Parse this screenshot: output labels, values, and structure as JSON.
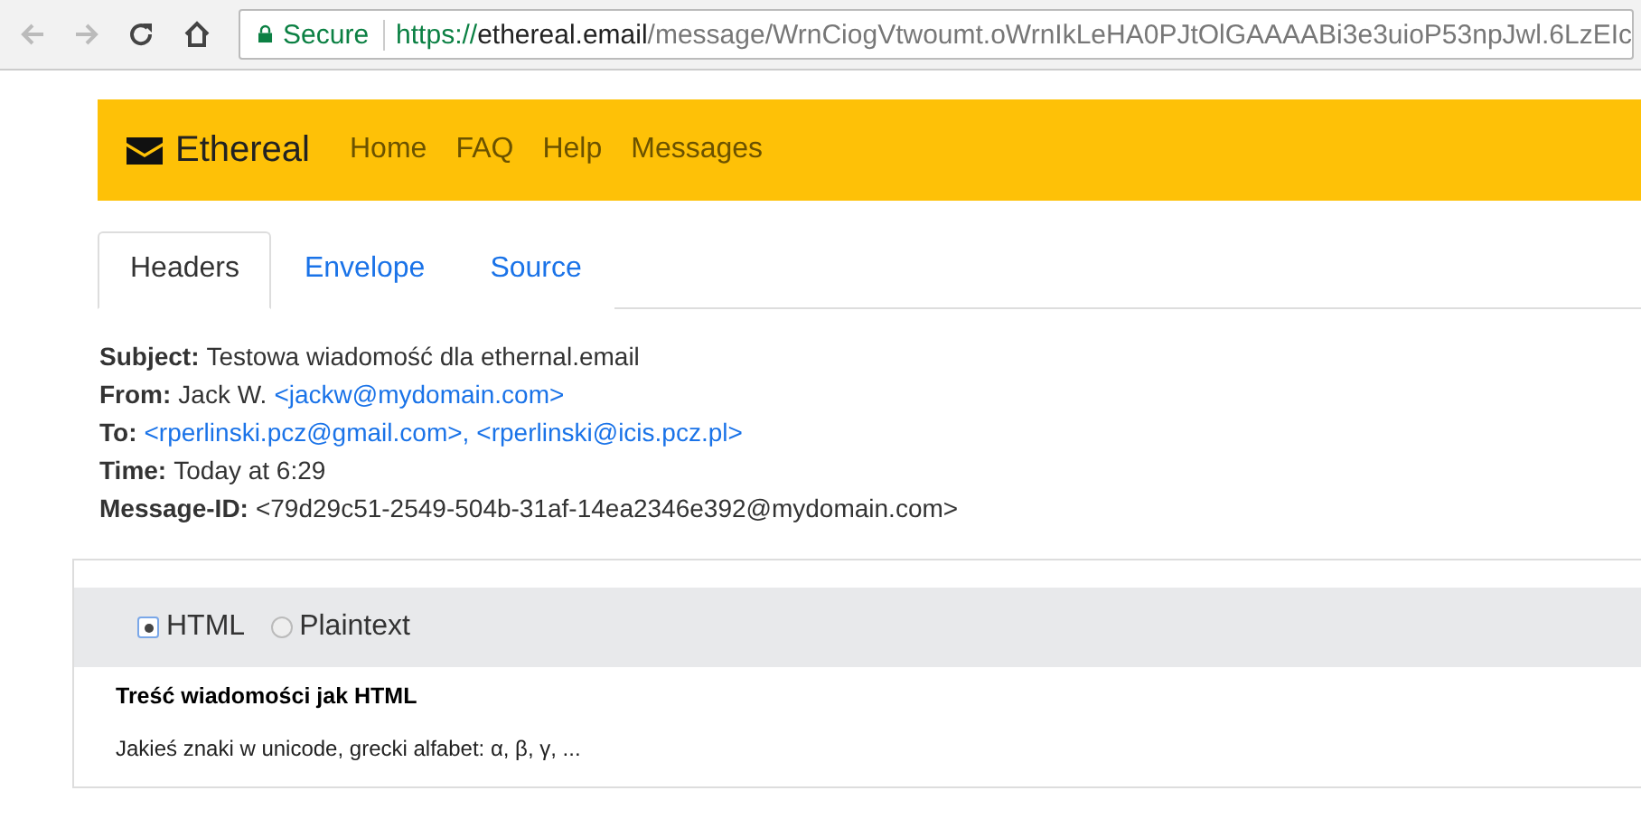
{
  "browser": {
    "security": "Secure",
    "url": {
      "scheme": "https://",
      "host": "ethereal.email",
      "path": "/message/WrnCiogVtwoumt.oWrnIkLeHA0PJtOlGAAAABi3e3uioP53npJwl.6LzEIc"
    }
  },
  "navbar": {
    "brand": "Ethereal",
    "links": [
      "Home",
      "FAQ",
      "Help",
      "Messages"
    ]
  },
  "tabs": [
    {
      "label": "Headers",
      "selected": true
    },
    {
      "label": "Envelope",
      "selected": false
    },
    {
      "label": "Source",
      "selected": false
    }
  ],
  "headers": [
    {
      "label": "Subject:",
      "parts": [
        {
          "text": "Testowa wiadomość dla ethernal.email",
          "link": false
        }
      ]
    },
    {
      "label": "From:",
      "parts": [
        {
          "text": "Jack W.",
          "link": false
        },
        {
          "text": "<jackw@mydomain.com>",
          "link": true
        }
      ]
    },
    {
      "label": "To:",
      "parts": [
        {
          "text": "<rperlinski.pcz@gmail.com>,",
          "link": true
        },
        {
          "text": "<rperlinski@icis.pcz.pl>",
          "link": true
        }
      ]
    },
    {
      "label": "Time:",
      "parts": [
        {
          "text": "Today at 6:29",
          "link": false
        }
      ]
    },
    {
      "label": "Message-ID:",
      "parts": [
        {
          "text": "<79d29c51-2549-504b-31af-14ea2346e392@mydomain.com>",
          "link": false
        }
      ]
    }
  ],
  "format_options": [
    {
      "label": "HTML",
      "selected": true
    },
    {
      "label": "Plaintext",
      "selected": false
    }
  ],
  "message": {
    "heading": "Treść wiadomości jak HTML",
    "body": "Jakieś znaki w unicode, grecki alfabet: α, β, γ, ..."
  }
}
